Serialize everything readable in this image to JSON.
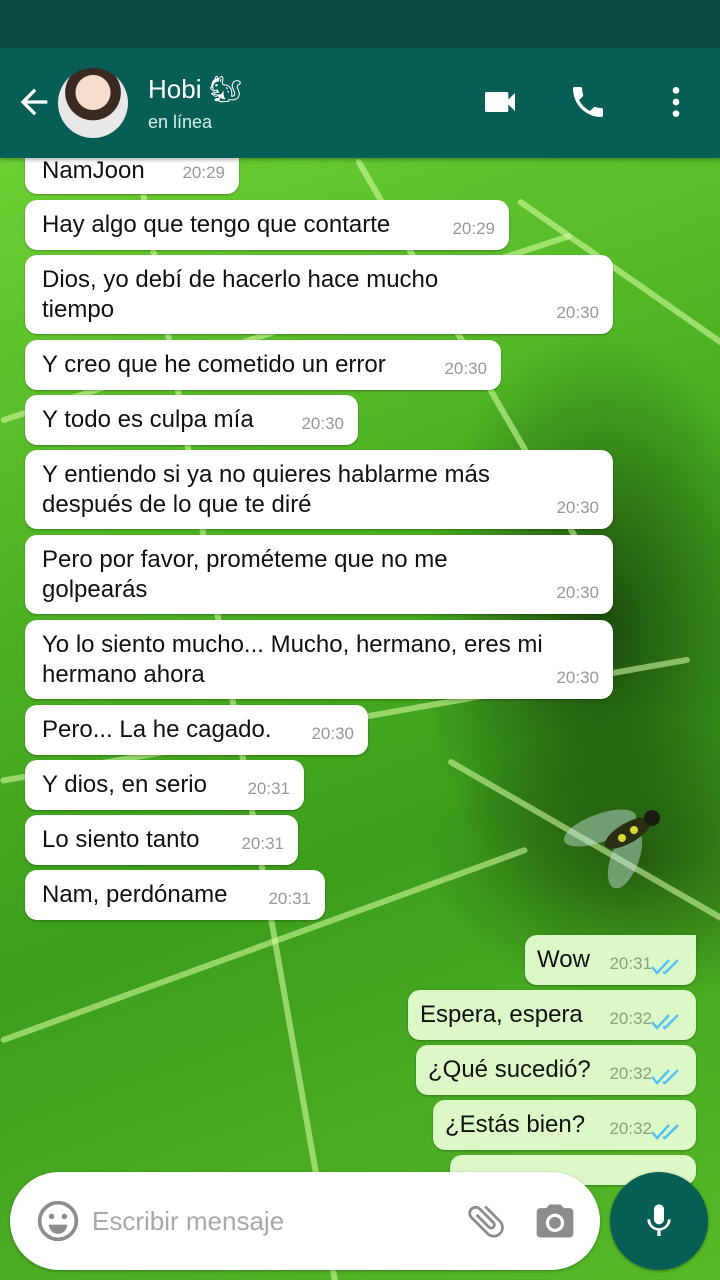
{
  "contact": {
    "name": "Hobi 🐿",
    "status": "en línea"
  },
  "incoming": [
    {
      "text": "NamJoon",
      "time": "20:29"
    },
    {
      "text": "Hay algo que tengo que contarte",
      "time": "20:29"
    },
    {
      "text": "Dios, yo debí de hacerlo hace mucho",
      "text2": "tiempo",
      "time": "20:30"
    },
    {
      "text": "Y creo que he cometido un error",
      "time": "20:30"
    },
    {
      "text": "Y todo es culpa mía",
      "time": "20:30"
    },
    {
      "text": "Y entiendo si ya no quieres hablarme más",
      "text2": "después de lo que te diré",
      "time": "20:30"
    },
    {
      "text": "Pero por favor, prométeme que no me",
      "text2": "golpearás",
      "time": "20:30"
    },
    {
      "text": "Yo lo siento mucho... Mucho, hermano, eres mi",
      "text2": "hermano ahora",
      "time": "20:30"
    },
    {
      "text": "Pero... La he cagado.",
      "time": "20:30"
    },
    {
      "text": "Y dios, en serio",
      "time": "20:31"
    },
    {
      "text": "Lo siento tanto",
      "time": "20:31"
    },
    {
      "text": "Nam, perdóname",
      "time": "20:31"
    }
  ],
  "outgoing": [
    {
      "text": "Wow",
      "time": "20:31"
    },
    {
      "text": "Espera, espera",
      "time": "20:32"
    },
    {
      "text": "¿Qué sucedió?",
      "time": "20:32"
    },
    {
      "text": "¿Estás bien?",
      "time": "20:32"
    }
  ],
  "composer": {
    "placeholder": "Escribir mensaje"
  },
  "icons": {
    "back": "arrow-left-icon",
    "video": "video-camera-icon",
    "call": "phone-icon",
    "menu": "more-vert-icon",
    "emoji": "emoji-icon",
    "attach": "paperclip-icon",
    "camera": "camera-icon",
    "mic": "microphone-icon",
    "read": "double-check-icon"
  },
  "colors": {
    "header": "#075e54",
    "outgoing_bubble": "#dcf8c6",
    "read_ticks": "#4fc3f7"
  }
}
